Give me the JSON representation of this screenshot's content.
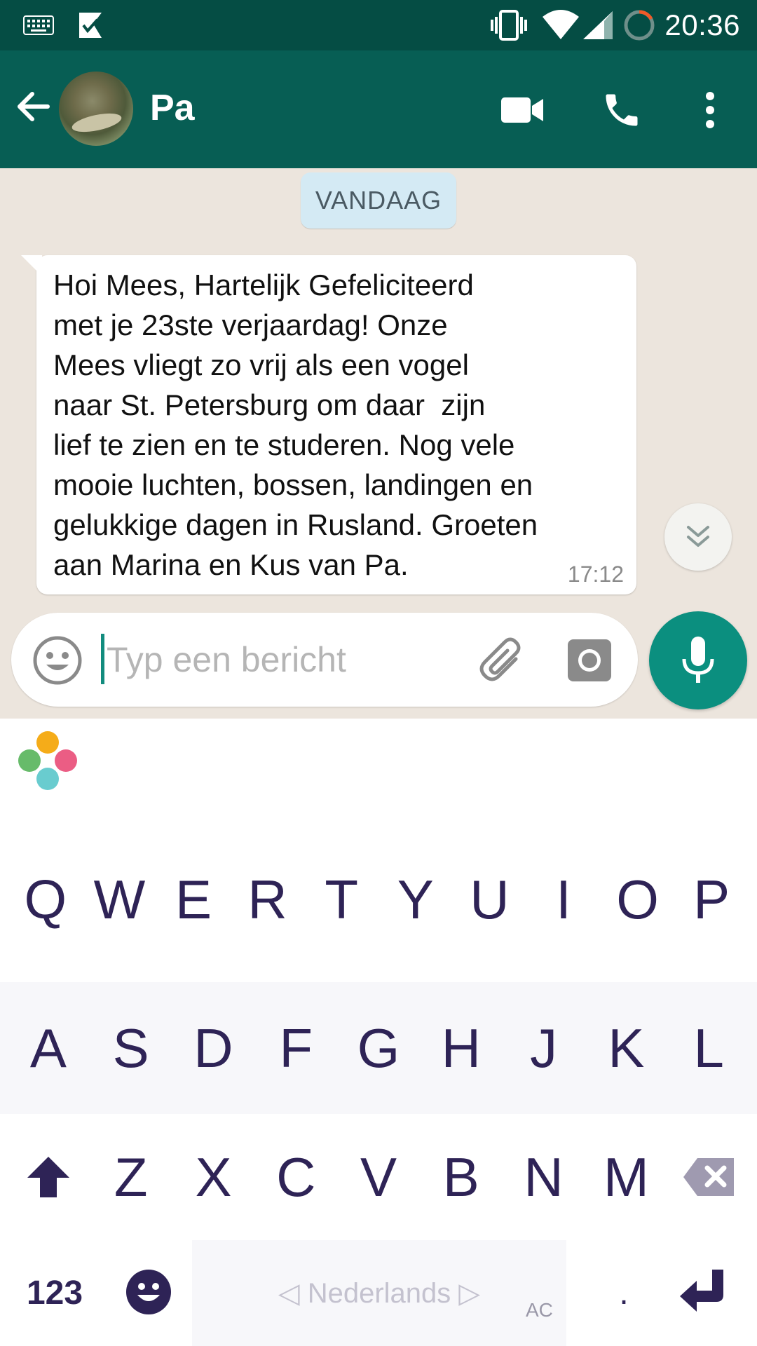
{
  "status_bar": {
    "time": "20:36",
    "icons": [
      "keyboard-icon",
      "checkmark-app-icon",
      "vibrate-icon",
      "wifi-icon",
      "signal-icon",
      "battery-ring-icon"
    ]
  },
  "header": {
    "contact_name": "Pa",
    "back_icon": "arrow-left-icon",
    "video_icon": "video-call-icon",
    "call_icon": "phone-icon",
    "menu_icon": "more-vert-icon"
  },
  "chat": {
    "date_chip": "VANDAAG",
    "messages": [
      {
        "text": "Hoi Mees, Hartelijk Gefeliciteerd\nmet je 23ste verjaardag! Onze\nMees vliegt zo vrij als een vogel\nnaar St. Petersburg om daar  zijn\nlief te zien en te studeren. Nog vele\nmooie luchten, bossen, landingen en\ngelukkige dagen in Rusland. Groeten\naan Marina en Kus van Pa.",
        "time": "17:12",
        "direction": "incoming"
      }
    ]
  },
  "composer": {
    "placeholder": "Typ een bericht",
    "value": ""
  },
  "keyboard": {
    "row1": [
      "Q",
      "W",
      "E",
      "R",
      "T",
      "Y",
      "U",
      "I",
      "O",
      "P"
    ],
    "row2": [
      "A",
      "S",
      "D",
      "F",
      "G",
      "H",
      "J",
      "K",
      "L"
    ],
    "row3": [
      "Z",
      "X",
      "C",
      "V",
      "B",
      "N",
      "M"
    ],
    "numbers_label": "123",
    "space_label": "◁ Nederlands ▷",
    "autocorrect_label": "AC",
    "period_label": "."
  },
  "colors": {
    "status_bar": "#054D44",
    "app_bar": "#075E54",
    "accent": "#0B8F7F",
    "chat_background": "#ECE5DD",
    "key_text": "#2E2356"
  }
}
